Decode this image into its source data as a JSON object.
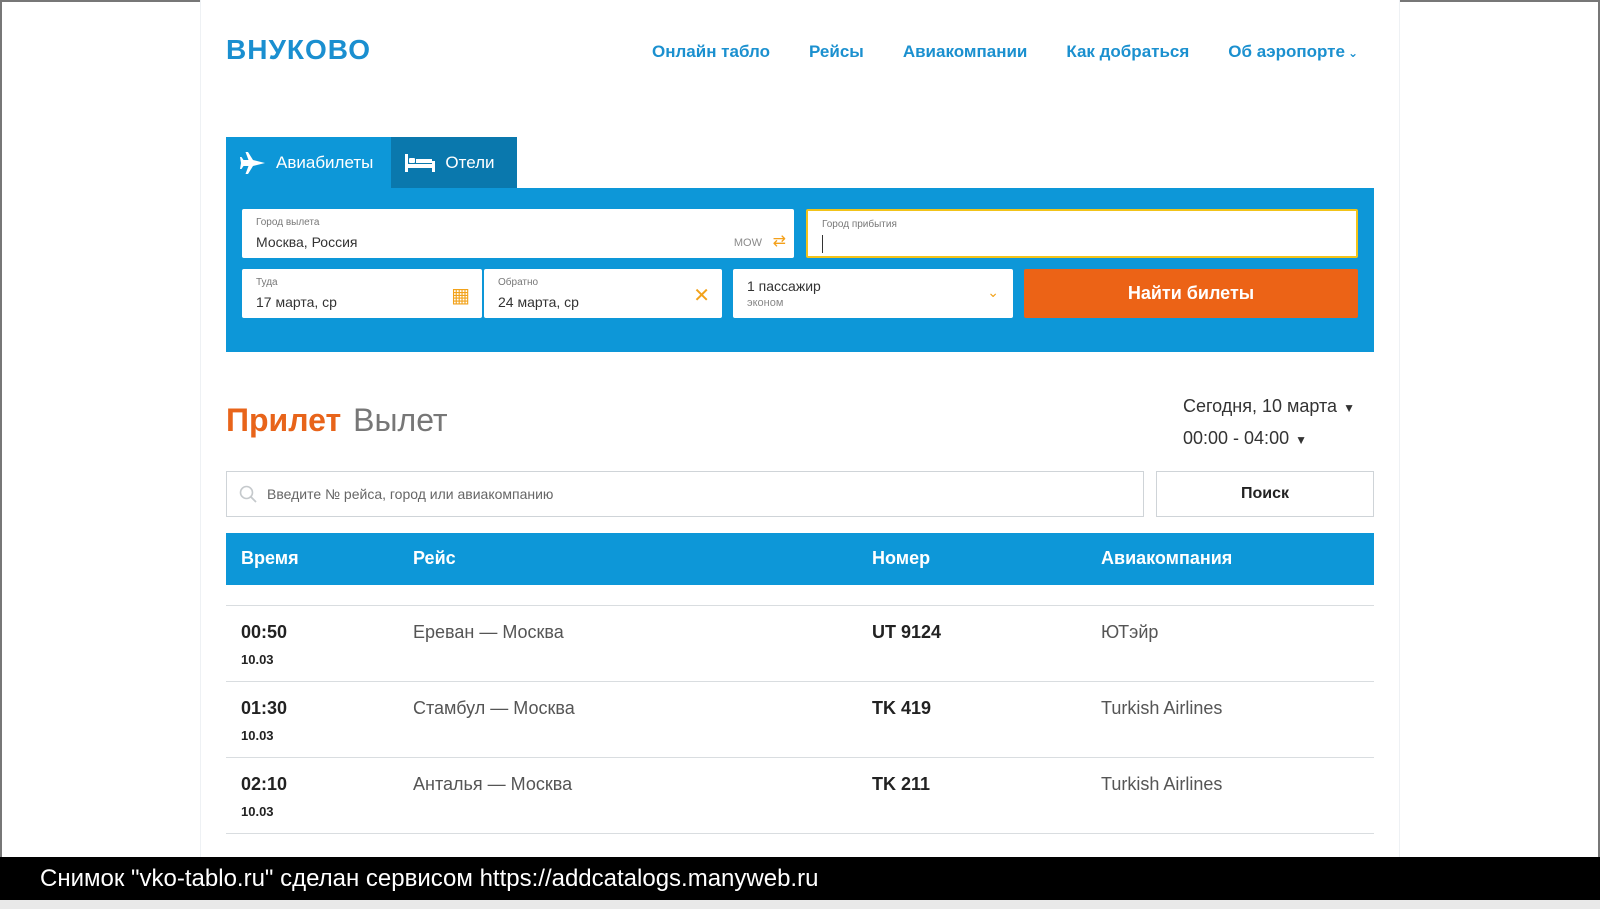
{
  "header": {
    "logo": "ВНУКОВО",
    "nav": [
      {
        "label": "Онлайн табло"
      },
      {
        "label": "Рейсы"
      },
      {
        "label": "Авиакомпании"
      },
      {
        "label": "Как добраться"
      },
      {
        "label": "Об аэропорте"
      }
    ]
  },
  "booking": {
    "tabs": [
      {
        "label": "Авиабилеты",
        "icon": "plane-icon"
      },
      {
        "label": "Отели",
        "icon": "bed-icon"
      }
    ],
    "from": {
      "label": "Город вылета",
      "value": "Москва, Россия",
      "code": "MOW"
    },
    "to": {
      "label": "Город прибытия",
      "value": ""
    },
    "there": {
      "label": "Туда",
      "value": "17 марта, ср"
    },
    "back": {
      "label": "Обратно",
      "value": "24 марта, ср"
    },
    "passengers": {
      "value": "1 пассажир",
      "class": "эконом"
    },
    "find_button": "Найти билеты"
  },
  "board": {
    "arrival_tab": "Прилет",
    "departure_tab": "Вылет",
    "date": "Сегодня, 10 марта",
    "time_range": "00:00 - 04:00",
    "search_placeholder": "Введите № рейса, город или авиакомпанию",
    "search_button": "Поиск",
    "columns": [
      "Время",
      "Рейс",
      "Номер",
      "Авиакомпания"
    ],
    "rows": [
      {
        "time": "00:50",
        "date": "10.03",
        "route": "Ереван — Москва",
        "number": "UT 9124",
        "airline": "ЮТэйр"
      },
      {
        "time": "01:30",
        "date": "10.03",
        "route": "Стамбул — Москва",
        "number": "TK 419",
        "airline": "Turkish Airlines"
      },
      {
        "time": "02:10",
        "date": "10.03",
        "route": "Анталья — Москва",
        "number": "TK 211",
        "airline": "Turkish Airlines"
      }
    ]
  },
  "footer_caption": "Снимок \"vko-tablo.ru\" сделан сервисом https://addcatalogs.manyweb.ru",
  "colors": {
    "brand": "#0d97d8",
    "accent": "#ec6316",
    "field_focus": "#f2c319"
  }
}
